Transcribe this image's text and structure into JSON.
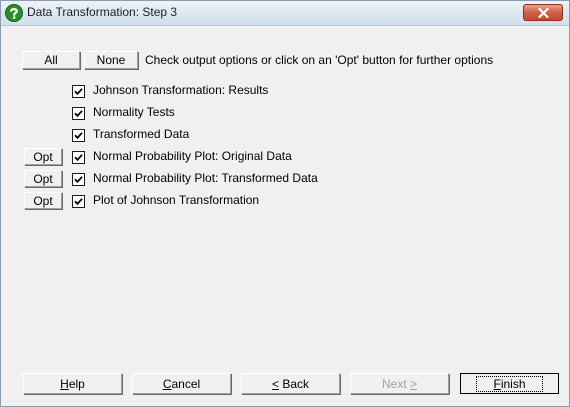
{
  "window": {
    "title": "Data Transformation: Step 3"
  },
  "header": {
    "all_label": "All",
    "none_label": "None",
    "instruction": "Check output options or click on an 'Opt' button for further options"
  },
  "options": [
    {
      "label": "Johnson Transformation: Results",
      "checked": true,
      "has_opt": false
    },
    {
      "label": "Normality Tests",
      "checked": true,
      "has_opt": false
    },
    {
      "label": "Transformed Data",
      "checked": true,
      "has_opt": false
    },
    {
      "label": "Normal Probability Plot: Original Data",
      "checked": true,
      "has_opt": true
    },
    {
      "label": "Normal Probability Plot: Transformed Data",
      "checked": true,
      "has_opt": true
    },
    {
      "label": "Plot of Johnson Transformation",
      "checked": true,
      "has_opt": true
    }
  ],
  "opt_label": "Opt",
  "footer": {
    "help": {
      "mnemonic": "H",
      "rest": "elp"
    },
    "cancel": {
      "mnemonic": "C",
      "rest": "ancel"
    },
    "back": {
      "mnemonic": "<",
      "rest": " Back"
    },
    "next": {
      "before": "Next ",
      "mnemonic": ">"
    },
    "finish": {
      "mnemonic": "F",
      "rest": "inish"
    }
  },
  "icons": {
    "title": "help-question-icon",
    "close": "close-icon",
    "check": "checkmark-icon"
  },
  "colors": {
    "title_icon": "#2a8f2a",
    "close_button": "#c9573d",
    "disabled_text": "#a0a0a0"
  }
}
